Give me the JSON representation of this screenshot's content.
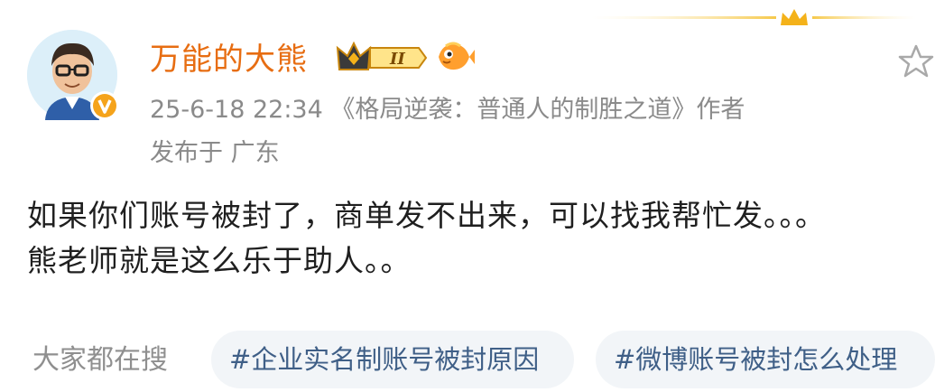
{
  "post": {
    "author": {
      "name": "万能的大熊",
      "level_badge": "II",
      "avatar_icon": "avatar-icon",
      "verified_badge": "v"
    },
    "meta": "25-6-18 22:34 《格局逆袭：普通人的制胜之道》作者",
    "location": "发布于 广东",
    "text_lines": [
      "如果你们账号被封了，商单发不出来，可以找我帮忙发。。。",
      "熊老师就是这么乐于助人。。"
    ]
  },
  "search": {
    "label": "大家都在搜",
    "chips": [
      "#企业实名制账号被封原因",
      "#微博账号被封怎么处理"
    ]
  },
  "colors": {
    "username": "#e76d12",
    "meta": "#8a8a8a",
    "chip_bg": "#f2f5f8",
    "chip_text": "#3f5f87",
    "gold": "#f4b21a"
  }
}
